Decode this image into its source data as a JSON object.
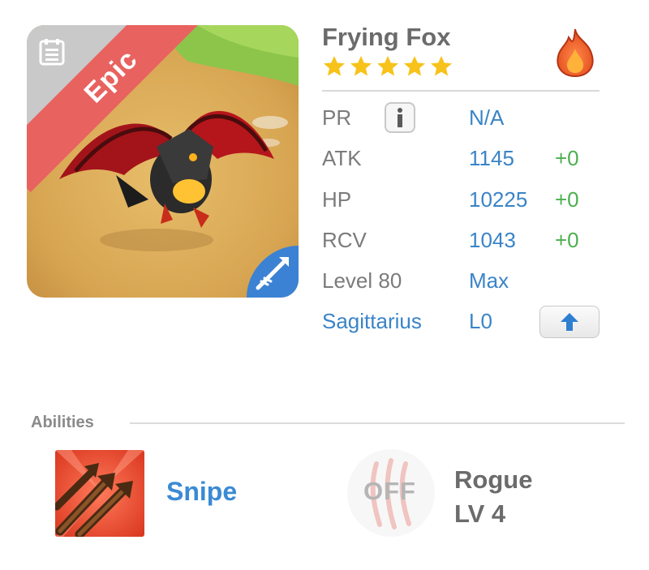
{
  "unit": {
    "name": "Frying Fox",
    "rarity_label": "Epic",
    "star_count": 5,
    "element_icon": "fire-icon",
    "class_icon": "archer-arrow-icon"
  },
  "stats": {
    "pr": {
      "label": "PR",
      "value": "N/A"
    },
    "atk": {
      "label": "ATK",
      "value": "1145",
      "bonus": "+0"
    },
    "hp": {
      "label": "HP",
      "value": "10225",
      "bonus": "+0"
    },
    "rcv": {
      "label": "RCV",
      "value": "1043",
      "bonus": "+0"
    },
    "level": {
      "label": "Level 80",
      "value": "Max"
    },
    "sign": {
      "label": "Sagittarius",
      "value": "L0"
    }
  },
  "abilities": {
    "title": "Abilities",
    "primary": {
      "name": "Snipe",
      "icon": "snipe-arrows-icon"
    },
    "secondary": {
      "status": "OFF",
      "name": "Rogue",
      "level": "LV 4",
      "icon": "claw-icon"
    }
  },
  "colors": {
    "ribbon": "#e8625f",
    "value_blue": "#3a84c7",
    "bonus_green": "#4caf50",
    "star_yellow": "#f7c21a"
  }
}
